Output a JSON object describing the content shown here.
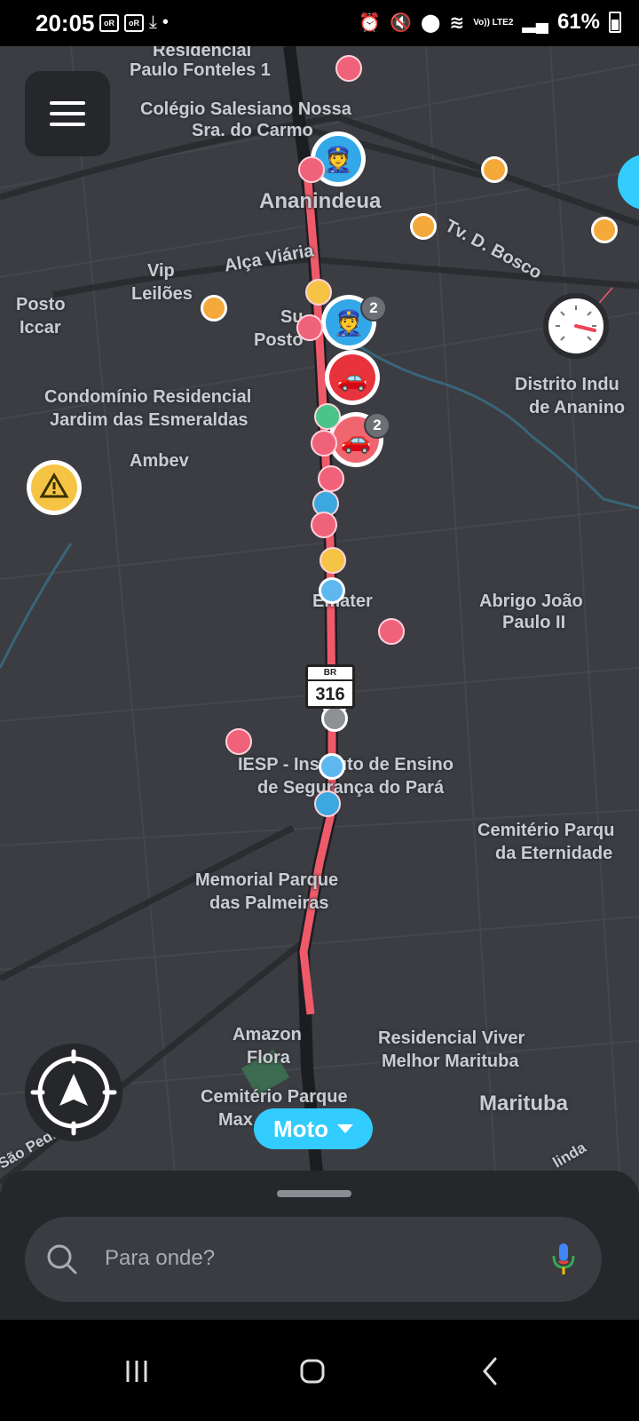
{
  "status_bar": {
    "time": "20:05",
    "battery": "61%",
    "network": "Vo)) LTE2",
    "chips": [
      "oR",
      "oR"
    ]
  },
  "map": {
    "labels": [
      {
        "id": "residencial",
        "text": "Residencial"
      },
      {
        "id": "paulo-fonteles",
        "text": "Paulo Fonteles 1"
      },
      {
        "id": "colegio",
        "text": "Colégio Salesiano Nossa"
      },
      {
        "id": "colegio2",
        "text": "Sra. do Carmo"
      },
      {
        "id": "ananindeua",
        "text": "Ananindeua"
      },
      {
        "id": "alca-viaria",
        "text": "Alça Viária"
      },
      {
        "id": "vip",
        "text": "Vip"
      },
      {
        "id": "leiloes",
        "text": "Leilões"
      },
      {
        "id": "posto",
        "text": "Posto"
      },
      {
        "id": "iccar",
        "text": "Iccar"
      },
      {
        "id": "su",
        "text": "Su"
      },
      {
        "id": "posto2",
        "text": "Posto"
      },
      {
        "id": "tv-bosco",
        "text": "Tv. D. Bosco"
      },
      {
        "id": "distrito",
        "text": "Distrito Indu"
      },
      {
        "id": "distrito2",
        "text": "de Ananino"
      },
      {
        "id": "condominio",
        "text": "Condomínio Residencial"
      },
      {
        "id": "condominio2",
        "text": "Jardim das Esmeraldas"
      },
      {
        "id": "ambev",
        "text": "Ambev"
      },
      {
        "id": "emater",
        "text": "Emater"
      },
      {
        "id": "abrigo",
        "text": "Abrigo João"
      },
      {
        "id": "abrigo2",
        "text": "Paulo II"
      },
      {
        "id": "iesp",
        "text": "IESP - Instituto de Ensino"
      },
      {
        "id": "iesp2",
        "text": "de Segurança do Pará"
      },
      {
        "id": "cemiterio",
        "text": "Cemitério Parqu"
      },
      {
        "id": "cemiterio2",
        "text": "da Eternidade"
      },
      {
        "id": "memorial",
        "text": "Memorial Parque"
      },
      {
        "id": "memorial2",
        "text": "das Palmeiras"
      },
      {
        "id": "amazon",
        "text": "Amazon"
      },
      {
        "id": "amazon2",
        "text": "Flora"
      },
      {
        "id": "residencial-viver",
        "text": "Residencial Viver"
      },
      {
        "id": "residencial-viver2",
        "text": "Melhor Marituba"
      },
      {
        "id": "marituba",
        "text": "Marituba"
      },
      {
        "id": "cem-max",
        "text": "Cemitério Parque"
      },
      {
        "id": "cem-max2",
        "text": "Max"
      },
      {
        "id": "sao-pedro",
        "text": "São Pedro"
      },
      {
        "id": "linda",
        "text": "linda"
      }
    ],
    "route_shield": {
      "top": "BR",
      "number": "316"
    },
    "report_counts": {
      "police": "2",
      "traffic": "2"
    },
    "colors": {
      "route": "#ef5a6a",
      "background": "#3b3d42",
      "accent": "#33ccff"
    }
  },
  "vehicle_pill": {
    "label": "Moto"
  },
  "search": {
    "placeholder": "Para onde?"
  }
}
